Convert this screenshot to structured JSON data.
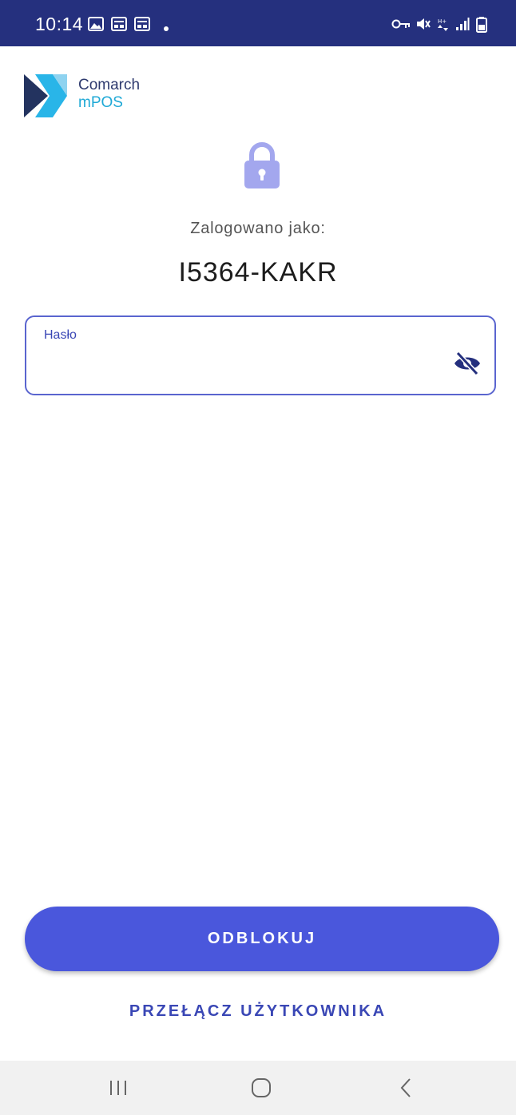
{
  "status_bar": {
    "time": "10:14",
    "left_icons": [
      "gallery-icon",
      "message-icon",
      "message-icon",
      "dot-icon"
    ],
    "right_icons": [
      "key-icon",
      "vibrate-mute-icon",
      "data-arrows-icon",
      "signal-icon",
      "battery-icon"
    ],
    "background": "#25307e"
  },
  "logo": {
    "line1": "Comarch",
    "line2": "mPOS"
  },
  "lock": {
    "icon": "lock-icon",
    "color": "#a3a7ee"
  },
  "login": {
    "logged_in_as_label": "Zalogowano jako:",
    "username": "I5364-KAKR"
  },
  "password": {
    "label": "Hasło",
    "value": "",
    "visibility_icon": "eye-off-icon"
  },
  "actions": {
    "unlock_label": "ODBLOKUJ",
    "switch_user_label": "PRZEŁĄCZ UŻYTKOWNIKA"
  },
  "nav_bar": {
    "buttons": [
      "recent-apps-icon",
      "home-icon",
      "back-icon"
    ]
  },
  "colors": {
    "accent": "#4a57dc",
    "field_border": "#5a65cf",
    "link": "#3a47b5"
  }
}
